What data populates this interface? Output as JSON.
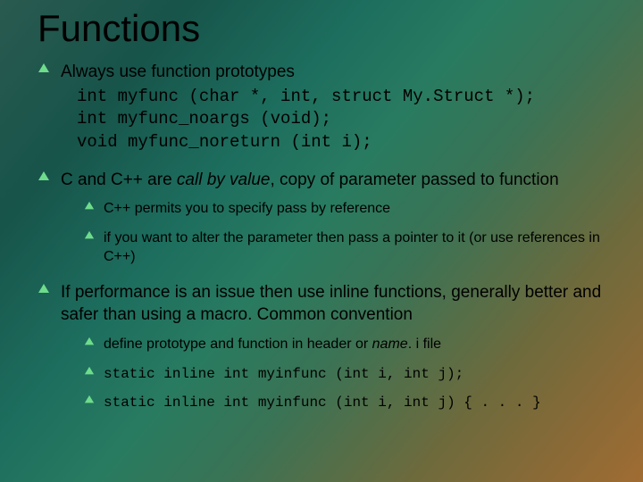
{
  "title": "Functions",
  "bullets": [
    {
      "text": "Always use function prototypes",
      "code": "int myfunc (char *, int, struct My.Struct *);\nint myfunc_noargs (void);\nvoid myfunc_noreturn (int i);"
    },
    {
      "prefix": "C and C++ are ",
      "italic": "call by value",
      "suffix": ", copy of parameter passed to function",
      "sub": [
        {
          "text": "C++ permits you to specify pass by reference"
        },
        {
          "text": "if you want to alter the parameter then pass a pointer to it (or use references in C++)"
        }
      ]
    },
    {
      "text": "If performance is an issue then use inline functions, generally better and safer than using a macro. Common convention",
      "sub": [
        {
          "prefix": "define prototype and function in header or ",
          "italic": "name",
          "suffix": ". i file"
        },
        {
          "code": "static inline int myinfunc (int i, int j);"
        },
        {
          "code": "static inline int myinfunc (int i, int j) { . . . }"
        }
      ]
    }
  ],
  "bullet_color": "#6fdc8c"
}
